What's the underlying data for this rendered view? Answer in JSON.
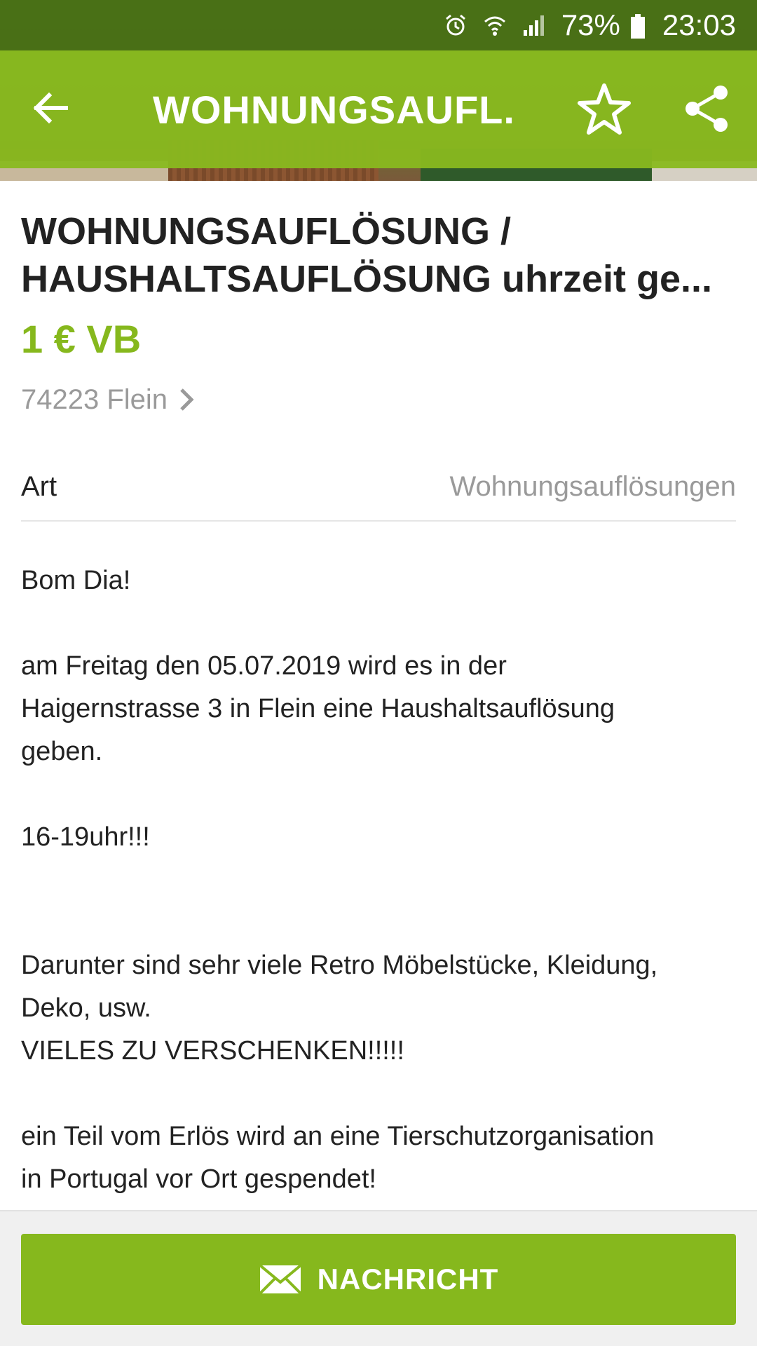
{
  "status_bar": {
    "battery_percent": "73%",
    "time": "23:03",
    "icons": [
      "alarm-icon",
      "wifi-icon",
      "signal-icon",
      "battery-icon"
    ]
  },
  "app_bar": {
    "title": "WOHNUNGSAUFL...",
    "icons": [
      "back-arrow-icon",
      "star-icon",
      "share-icon"
    ]
  },
  "ad": {
    "title_line1": "WOHNUNGSAUFLÖSUNG /",
    "title_line2": "HAUSHALTSAUFLÖSUNG uhrzeit ge...",
    "price": "1 € VB",
    "location": "74223 Flein",
    "attribute": {
      "key": "Art",
      "value": "Wohnungsauflösungen"
    },
    "description": [
      "Bom Dia!",
      "",
      "am Freitag den 05.07.2019 wird es in der",
      "Haigernstrasse 3 in Flein eine Haushaltsauflösung",
      "geben.",
      "",
      "16-19uhr!!!",
      "",
      "",
      "Darunter sind sehr viele Retro Möbelstücke, Kleidung,",
      "Deko, usw.",
      "VIELES ZU VERSCHENKEN!!!!!",
      "",
      "ein Teil vom Erlös wird an eine Tierschutzorganisation",
      "in Portugal vor Ort gespendet!"
    ]
  },
  "bottom": {
    "message_button_label": "NACHRICHT",
    "icon": "envelope-icon"
  },
  "colors": {
    "accent": "#86b81d",
    "status_bar": "#466e14",
    "secondary_text": "#9a9a9a"
  }
}
